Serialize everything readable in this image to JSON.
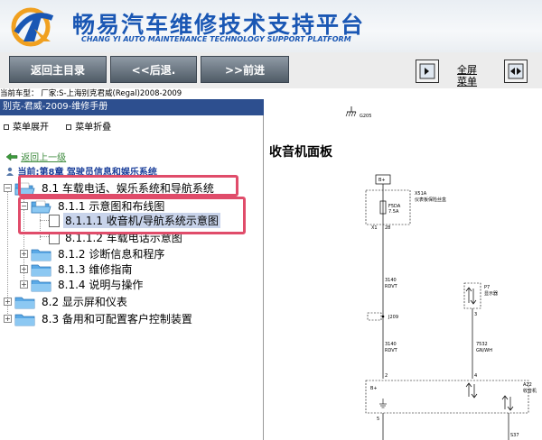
{
  "header": {
    "title_cn": "畅易汽车维修技术支持平台",
    "title_en": "CHANG YI AUTO MAINTENANCE TECHNOLOGY SUPPORT PLATFORM"
  },
  "toolbar": {
    "home_label": "返回主目录",
    "back_label": "<<后退.",
    "forward_label": ">>前进",
    "fullscreen_line1": "全屏",
    "fullscreen_line2": "菜单"
  },
  "vehicle_info": "当前车型：  厂家:S-上海别克君威(Regal)2008-2009",
  "left_panel": {
    "manual_title": "别克-君威-2009-维修手册",
    "expand_menu": "菜单展开",
    "collapse_menu": "菜单折叠",
    "back_link": "返回上一级",
    "current_chapter": "当前:第8章 驾驶员信息和娱乐系统",
    "tree": [
      {
        "label": "8.1 车载电话、娱乐系统和导航系统",
        "expander": "−"
      },
      {
        "label": "8.1.1 示意图和布线图",
        "expander": "−"
      },
      {
        "label": "8.1.1.1 收音机/导航系统示意图"
      },
      {
        "label": "8.1.1.2 车载电话示意图"
      },
      {
        "label": "8.1.2 诊断信息和程序",
        "expander": "+"
      },
      {
        "label": "8.1.3 维修指南",
        "expander": "+"
      },
      {
        "label": "8.1.4 说明与操作",
        "expander": "+"
      },
      {
        "label": "8.2 显示屏和仪表",
        "expander": "+"
      },
      {
        "label": "8.3 备用和可配置客户控制装置",
        "expander": "+"
      }
    ]
  },
  "diagram": {
    "title": "收音机面板",
    "labels": {
      "g205": "G205",
      "bplus_top": "B+",
      "x51a": "X51A",
      "x51a_desc": "仪表板保险丝盒",
      "fuse": "F5DA",
      "fuse_rating": "7.5A",
      "x1": "X1",
      "pin28": "28",
      "wire1_num": "3140",
      "wire1_color": "RDVT",
      "j209": "J209",
      "wire2_num": "3140",
      "wire2_color": "RDVT",
      "p7": "P7",
      "p7_desc": "显示器",
      "pin3": "3",
      "wire3_num": "7532",
      "wire3_color": "GN/WH",
      "pin2": "2",
      "pin4": "4",
      "a22": "A22",
      "a22_desc": "收音机",
      "bplus_module": "B+",
      "pin5": "5",
      "s37": "S37"
    }
  },
  "colors": {
    "brand_blue": "#1a57b4",
    "manual_bar": "#2d4f8f",
    "highlight": "#e04c6a",
    "selected_bg": "#c8d3ea"
  }
}
